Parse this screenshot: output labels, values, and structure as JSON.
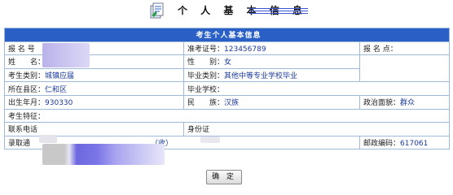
{
  "header": {
    "title": "个 人 基 本 信 息"
  },
  "table": {
    "caption": "考生个人基本信息",
    "row1": {
      "baoming_label": "报 名 号",
      "zhunkao_label": "准考证号：",
      "zhunkao_value": "123456789",
      "bmd_label": "报 名 点："
    },
    "row2": {
      "name_label": "姓　　名：",
      "gender_label": "性　　别：",
      "gender_value": "女"
    },
    "row3": {
      "kslb_label": "考生类别：",
      "kslb_value": "城镇应届",
      "bylb_label": "毕业类别：",
      "bylb_value": "其他中等专业学校毕业"
    },
    "row4": {
      "region_label": "所在县区：",
      "region_value": "仁和区",
      "school_label": "毕业学校："
    },
    "row5": {
      "birth_label": "出生年月：",
      "birth_value": "930330",
      "nation_label": "民　　族：",
      "nation_value": "汉族",
      "political_label": "政治面貌：",
      "political_value": "群众"
    },
    "row6": {
      "feature_label": "考生特征："
    },
    "row7": {
      "phone_label": "联系电话",
      "id_label": "身份证"
    },
    "row8": {
      "address_label": "录取通",
      "address_tail": "（收）",
      "postal_label": "邮政编码：",
      "postal_value": "617061"
    }
  },
  "buttons": {
    "ok_label": "确 定"
  },
  "colors": {
    "header_blue": "#2a5fc6",
    "border": "#9fb9d8",
    "value_blue": "#1a3a9a"
  }
}
